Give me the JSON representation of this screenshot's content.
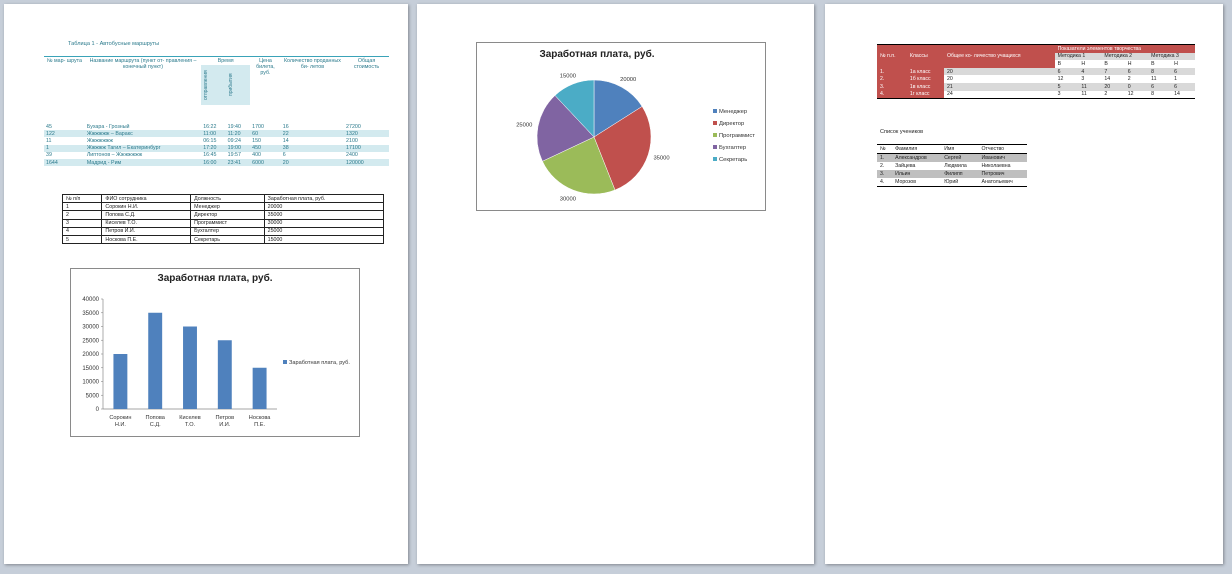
{
  "route_table": {
    "caption": "Таблица 1 - Автобусные маршруты",
    "headers": {
      "num": "№ мар- шрута",
      "name": "Название маршрута (пункт от- правления – конечный пункт)",
      "time": "Время",
      "departure": "отправления",
      "arrival": "прибытия",
      "price": "Цена билета, руб.",
      "count": "Количество проданных би- летов",
      "total": "Общая стоимость"
    },
    "rows": [
      [
        "45",
        "Бухара - Грозный",
        "16:22",
        "19:40",
        "1700",
        "16",
        "27200"
      ],
      [
        "122",
        "Жжжжжж – Варакс",
        "11:00",
        "11:20",
        "60",
        "22",
        "1320"
      ],
      [
        "11",
        "Жжжжжжж",
        "06:15",
        "09:24",
        "150",
        "14",
        "2100"
      ],
      [
        "1",
        "Жжжжж Тагил – Екатеринбург",
        "17:20",
        "19:00",
        "450",
        "38",
        "17100"
      ],
      [
        "39",
        "Липтонов – Жжжжжжж",
        "16:45",
        "19:57",
        "400",
        "6",
        "2400"
      ],
      [
        "1644",
        "Мадрид - Рим",
        "16:00",
        "23:41",
        "6000",
        "20",
        "120000"
      ]
    ]
  },
  "staff_table": {
    "headers": [
      "№ п/п",
      "ФИО сотрудника",
      "Должность",
      "Заработная плата, руб."
    ],
    "rows": [
      [
        "1",
        "Сорокин Н.И.",
        "Менеджер",
        "20000"
      ],
      [
        "2",
        "Попова С.Д.",
        "Директор",
        "35000"
      ],
      [
        "3",
        "Киселев Т.О.",
        "Программист",
        "30000"
      ],
      [
        "4",
        "Петров И.И.",
        "Бухгалтер",
        "25000"
      ],
      [
        "5",
        "Носкова П.Е.",
        "Секретарь",
        "15000"
      ]
    ]
  },
  "chart_data": [
    {
      "type": "bar",
      "title": "Заработная плата, руб.",
      "categories": [
        "Сорокин Н.И.",
        "Попова С.Д.",
        "Киселев Т.О.",
        "Петров И.И.",
        "Носкова П.Е."
      ],
      "series": [
        {
          "name": "Заработная плата, руб.",
          "values": [
            20000,
            35000,
            30000,
            25000,
            15000
          ],
          "color": "#4f81bd"
        }
      ],
      "ylim": [
        0,
        40000
      ],
      "yticks": [
        0,
        5000,
        10000,
        15000,
        20000,
        25000,
        30000,
        35000,
        40000
      ],
      "legend": "right"
    },
    {
      "type": "pie",
      "title": "Заработная плата, руб.",
      "labels": [
        "Менеджер",
        "Директор",
        "Программист",
        "Бухгалтер",
        "Секретарь"
      ],
      "values": [
        20000,
        35000,
        30000,
        25000,
        15000
      ],
      "colors": [
        "#4f81bd",
        "#c0504d",
        "#9bbb59",
        "#8064a2",
        "#4bacc6"
      ],
      "legend": "right"
    }
  ],
  "class_table": {
    "headers": {
      "num": "№ п.п.",
      "classes": "Классы",
      "total": "Общее ко- личество учащихся",
      "indicators": "Показатели элементов творчества",
      "methods": [
        "Методика 1",
        "Методика 2",
        "Методика 3"
      ],
      "sub": [
        "В",
        "Н",
        "В",
        "Н",
        "В",
        "Н"
      ]
    },
    "rows": [
      [
        "1.",
        "1а класс",
        "20",
        "6",
        "4",
        "7",
        "6",
        "8",
        "6"
      ],
      [
        "2.",
        "1б класс",
        "20",
        "12",
        "3",
        "14",
        "2",
        "11",
        "1"
      ],
      [
        "3.",
        "1в класс",
        "21",
        "5",
        "11",
        "20",
        "0",
        "6",
        "6"
      ],
      [
        "4.",
        "1г класс",
        "24",
        "3",
        "11",
        "2",
        "12",
        "8",
        "14"
      ]
    ]
  },
  "students": {
    "caption": "Список учеников",
    "headers": [
      "№",
      "Фамилия",
      "Имя",
      "Отчество"
    ],
    "rows": [
      [
        "1.",
        "Александров",
        "Сергей",
        "Иванович"
      ],
      [
        "2.",
        "Зайцева",
        "Людмила",
        "Николаевна"
      ],
      [
        "3.",
        "Ильин",
        "Филипп",
        "Петрович"
      ],
      [
        "4.",
        "Морозов",
        "Юрий",
        "Анатольевич"
      ]
    ]
  }
}
